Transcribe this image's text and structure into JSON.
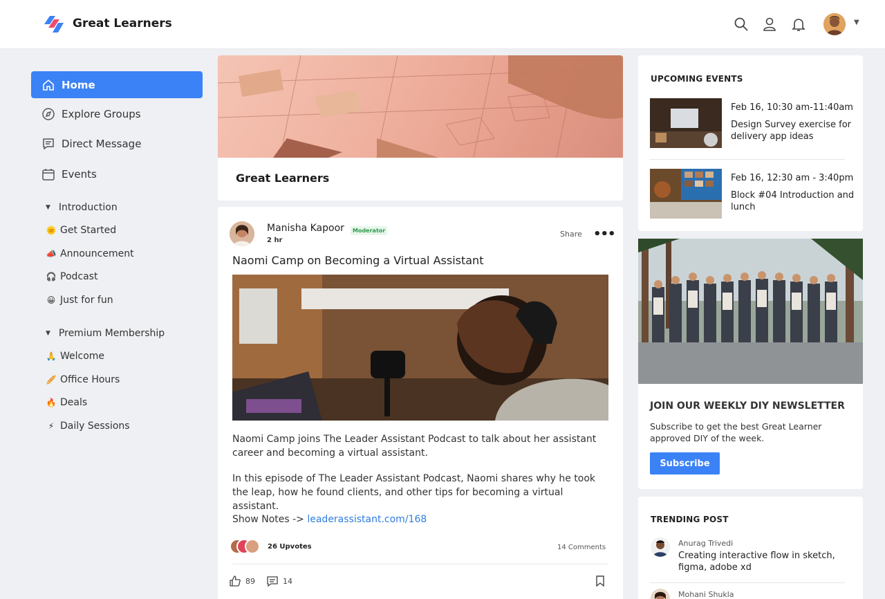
{
  "header": {
    "brand": "Great Learners",
    "icons": [
      "search-icon",
      "user-icon",
      "bell-icon"
    ],
    "accent": "#3b82f6"
  },
  "sidebar": {
    "nav": [
      {
        "label": "Home",
        "icon": "home-icon",
        "active": true
      },
      {
        "label": "Explore Groups",
        "icon": "compass-icon"
      },
      {
        "label": "Direct Message",
        "icon": "message-icon"
      },
      {
        "label": "Events",
        "icon": "calendar-icon"
      }
    ],
    "sections": [
      {
        "title": "Introduction",
        "items": [
          {
            "emoji": "🌞",
            "label": "Get Started"
          },
          {
            "emoji": "📣",
            "label": "Announcement"
          },
          {
            "emoji": "🎧",
            "label": "Podcast"
          },
          {
            "emoji": "😀",
            "label": "Just for fun"
          }
        ]
      },
      {
        "title": "Premium Membership",
        "items": [
          {
            "emoji": "🙏",
            "label": "Welcome"
          },
          {
            "emoji": "🥖",
            "label": "Office Hours"
          },
          {
            "emoji": "🔥",
            "label": "Deals"
          },
          {
            "emoji": "⚡",
            "label": "Daily Sessions"
          }
        ]
      }
    ]
  },
  "group": {
    "title": "Great Learners"
  },
  "post": {
    "author": "Manisha Kapoor",
    "badge": "Moderator",
    "time": "2 hr",
    "share": "Share",
    "title": "Naomi Camp on Becoming a Virtual Assistant",
    "paragraph1": "Naomi Camp joins The Leader Assistant Podcast to talk about her assistant career and becoming a virtual assistant.",
    "paragraph2": "In this episode of The Leader Assistant Podcast, Naomi shares why he took the leap, how he found clients, and other tips for becoming a virtual assistant.",
    "notes_prefix": "Show Notes -> ",
    "notes_link": "leaderassistant.com/168",
    "upvotes": "26 Upvotes",
    "comments": "14 Comments",
    "likes": "89",
    "comment_count": "14"
  },
  "events": {
    "heading": "UPCOMING EVENTS",
    "items": [
      {
        "time": "Feb 16, 10:30 am-11:40am",
        "title": "Design Survey exercise for delivery app ideas"
      },
      {
        "time": "Feb 16, 12:30 am - 3:40pm",
        "title": "Block #04 Introduction and lunch"
      }
    ]
  },
  "newsletter": {
    "title": "JOIN OUR WEEKLY DIY NEWSLETTER",
    "text": "Subscribe to get the best Great Learner approved DIY of the week.",
    "button": "Subscribe"
  },
  "trending": {
    "heading": "TRENDING POST",
    "items": [
      {
        "name": "Anurag Trivedi",
        "title": "Creating interactive flow in sketch, figma, adobe xd"
      },
      {
        "name": "Mohani Shukla",
        "title": ""
      }
    ]
  }
}
